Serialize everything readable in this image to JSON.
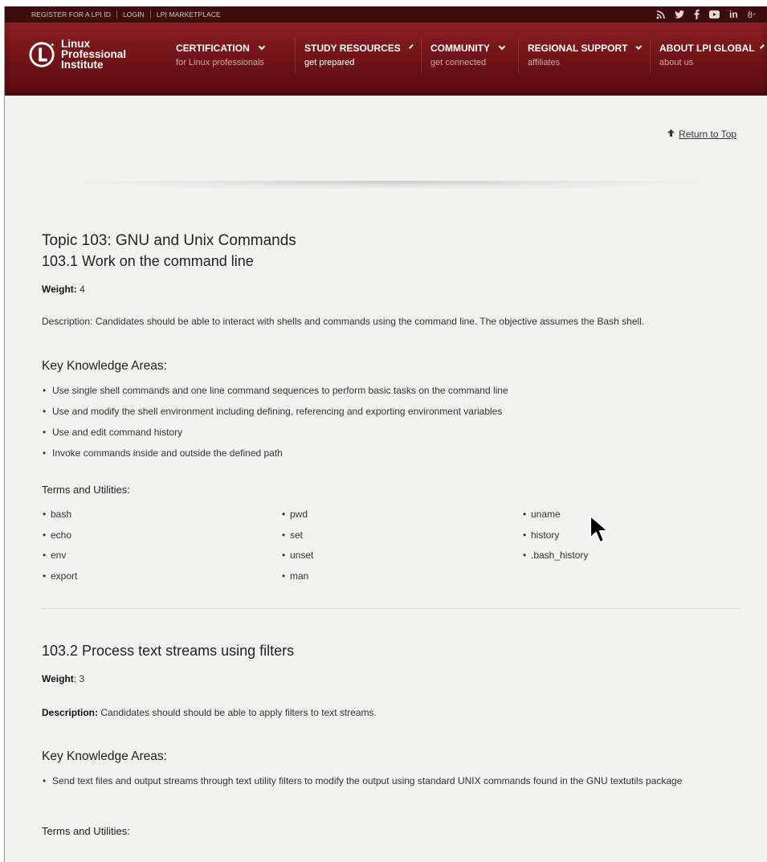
{
  "topbar": {
    "links": [
      "REGISTER FOR A LPI ID",
      "LOGIN",
      "LPI MARKETPLACE"
    ],
    "social_icons": [
      "rss-icon",
      "twitter-icon",
      "facebook-icon",
      "youtube-icon",
      "linkedin-icon",
      "googleplus-icon"
    ],
    "social_glyphs": [
      "ʾ",
      "t",
      "f",
      "▶",
      "in",
      "g+"
    ]
  },
  "logo": {
    "line1": "Linux",
    "line2": "Professional",
    "line3": "Institute"
  },
  "nav": [
    {
      "title": "CERTIFICATION",
      "sub": "for Linux professionals"
    },
    {
      "title": "STUDY RESOURCES",
      "sub": "get prepared"
    },
    {
      "title": "COMMUNITY",
      "sub": "get connected"
    },
    {
      "title": "REGIONAL SUPPORT",
      "sub": "affiliates"
    },
    {
      "title": "ABOUT LPI GLOBAL",
      "sub": "about us"
    }
  ],
  "return_to_top": "Return to Top",
  "topic_title": "Topic 103: GNU and Unix Commands",
  "objectives": [
    {
      "title": "103.1 Work on the command line",
      "weight_label": "Weight:",
      "weight_value": " 4",
      "description": "Description: Candidates should be able to interact with shells and commands using the command line. The objective assumes the Bash shell.",
      "kka_title": "Key Knowledge Areas:",
      "kka": [
        "Use single shell commands and one line command sequences to perform basic tasks on the command line",
        "Use and modify the shell environment including defining, referencing and exporting environment variables",
        "Use and edit command history",
        "Invoke commands inside and outside the defined path"
      ],
      "terms_title": "Terms and Utilities:",
      "terms_columns": [
        [
          "bash",
          "echo",
          "env",
          "export"
        ],
        [
          "pwd",
          "set",
          "unset",
          "man"
        ],
        [
          "uname",
          "history",
          ".bash_history"
        ]
      ]
    },
    {
      "title": "103.2 Process text streams using filters",
      "weight_label": "Weight",
      "weight_value": ": 3",
      "description_label": "Description:",
      "description": " Candidates should should be able to apply filters to text streams.",
      "kka_title": "Key Knowledge Areas:",
      "kka": [
        "Send text files and output streams through text utility filters to modify the output using standard UNIX commands found in the GNU textutils package"
      ],
      "terms_title": "Terms and Utilities:"
    }
  ]
}
